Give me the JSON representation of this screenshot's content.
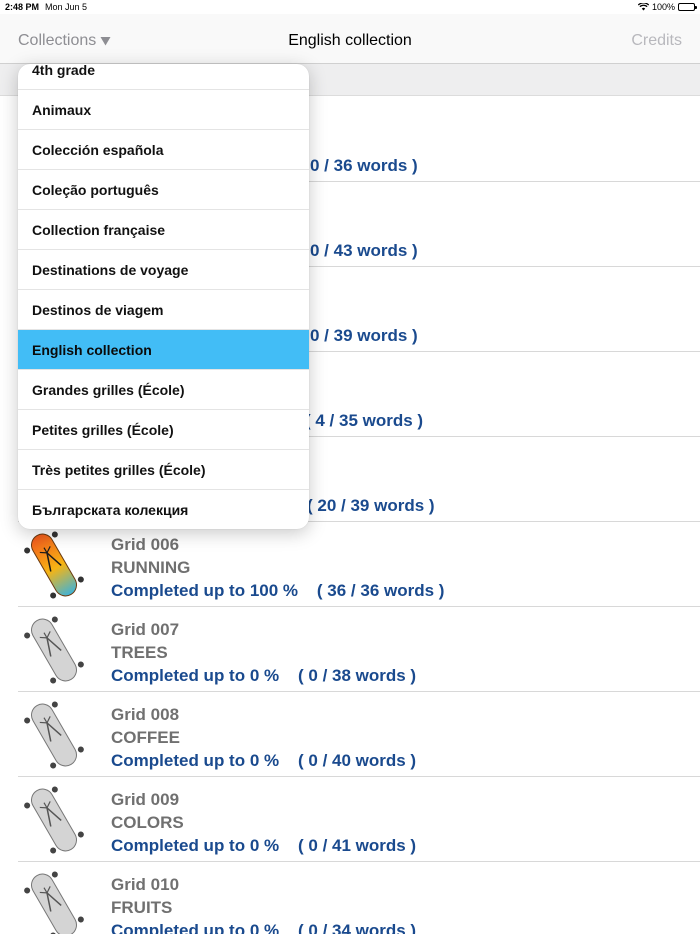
{
  "status": {
    "time": "2:48 PM",
    "date": "Mon Jun 5",
    "battery": "100%"
  },
  "nav": {
    "left_label": "Collections",
    "title": "English collection",
    "right_label": "Credits"
  },
  "dropdown": {
    "items": [
      {
        "label": "4th grade"
      },
      {
        "label": "Animaux"
      },
      {
        "label": "Colección española"
      },
      {
        "label": "Coleção português"
      },
      {
        "label": "Collection française"
      },
      {
        "label": "Destinations de voyage"
      },
      {
        "label": "Destinos de viagem"
      },
      {
        "label": "English collection",
        "selected": true
      },
      {
        "label": "Grandes grilles (École)"
      },
      {
        "label": "Petites grilles (École)"
      },
      {
        "label": "Très petites grilles (École)"
      },
      {
        "label": "Българската колекция"
      }
    ]
  },
  "grids": [
    {
      "progress": "0 / 36 words )"
    },
    {
      "progress": "0 / 43 words )"
    },
    {
      "progress": "0 / 39 words )"
    },
    {
      "progress": "( 4 / 35 words )"
    },
    {
      "progress": "( 20 / 39 words )"
    },
    {
      "name": "Grid 006",
      "theme": "RUNNING",
      "progress": "Completed up to 100 %    ( 36 / 36 words )",
      "completed_fraction": 1.0
    },
    {
      "name": "Grid 007",
      "theme": "TREES",
      "progress": "Completed up to 0 %    ( 0 / 38 words )",
      "completed_fraction": 0
    },
    {
      "name": "Grid 008",
      "theme": "COFFEE",
      "progress": "Completed up to 0 %    ( 0 / 40 words )",
      "completed_fraction": 0
    },
    {
      "name": "Grid 009",
      "theme": "COLORS",
      "progress": "Completed up to 0 %    ( 0 / 41 words )",
      "completed_fraction": 0
    },
    {
      "name": "Grid 010",
      "theme": "FRUITS",
      "progress": "Completed up to 0 %    ( 0 / 34 words )",
      "completed_fraction": 0
    }
  ],
  "colors": {
    "accent": "#42bdf6",
    "progress_text": "#1a4a8e"
  }
}
